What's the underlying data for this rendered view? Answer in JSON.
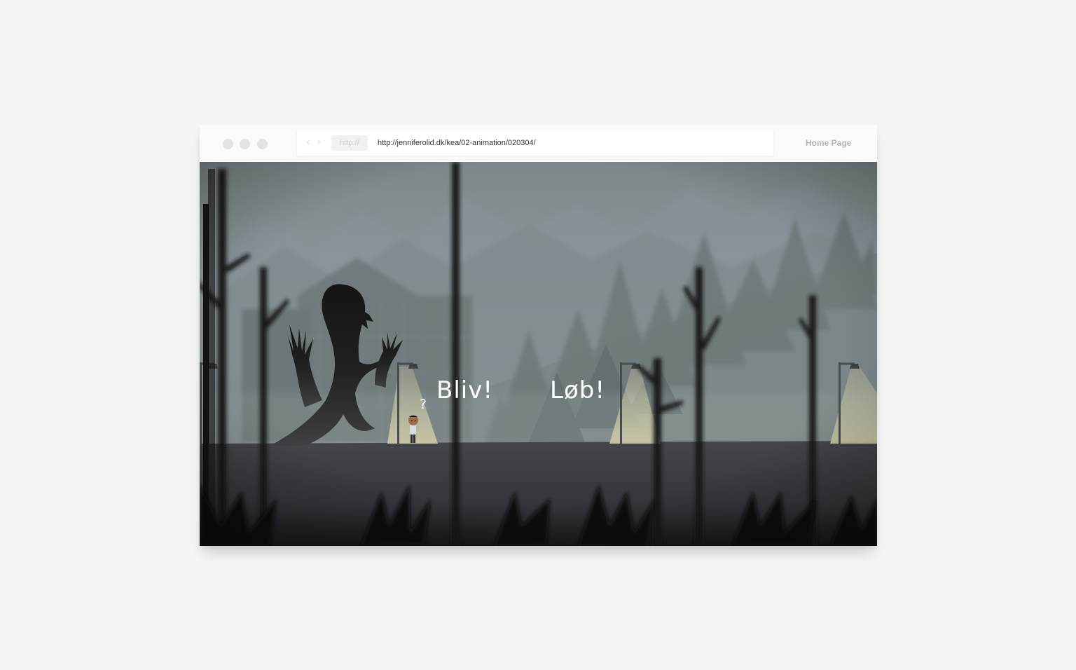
{
  "browser": {
    "address_protocol": "http://",
    "url": "http://jenniferolid.dk/kea/02-animation/020304/",
    "home_label": "Home Page",
    "back_glyph": "‹",
    "forward_glyph": "›"
  },
  "scene": {
    "choice_stay": "Bliv!",
    "choice_run": "Løb!",
    "question_mark": "?",
    "colors": {
      "sky": "#8d9799",
      "ground": "#3b3d42",
      "lamp_light": "#c6c4a4",
      "silhouette": "#1b1b1c"
    }
  }
}
